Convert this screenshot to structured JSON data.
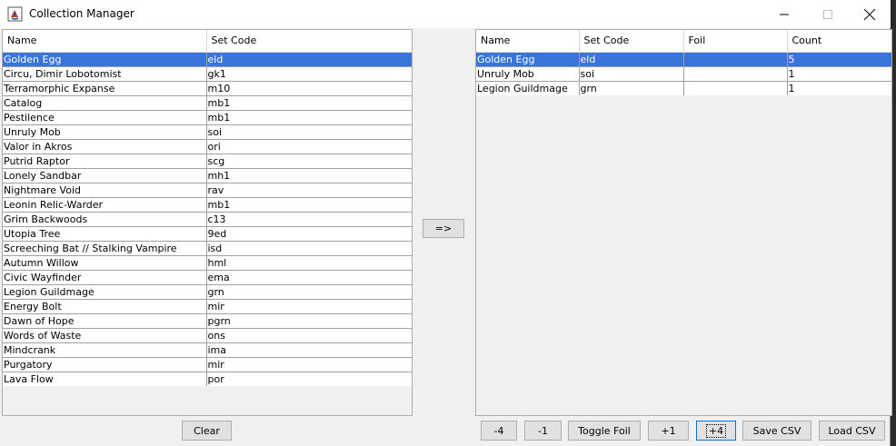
{
  "window": {
    "title": "Collection Manager"
  },
  "left_table": {
    "columns": [
      "Name",
      "Set Code"
    ],
    "rows": [
      {
        "name": "Golden Egg",
        "set": "eld",
        "selected": true
      },
      {
        "name": "Circu, Dimir Lobotomist",
        "set": "gk1"
      },
      {
        "name": "Terramorphic Expanse",
        "set": "m10"
      },
      {
        "name": "Catalog",
        "set": "mb1"
      },
      {
        "name": "Pestilence",
        "set": "mb1"
      },
      {
        "name": "Unruly Mob",
        "set": "soi"
      },
      {
        "name": "Valor in Akros",
        "set": "ori"
      },
      {
        "name": "Putrid Raptor",
        "set": "scg"
      },
      {
        "name": "Lonely Sandbar",
        "set": "mh1"
      },
      {
        "name": "Nightmare Void",
        "set": "rav"
      },
      {
        "name": "Leonin Relic-Warder",
        "set": "mb1"
      },
      {
        "name": "Grim Backwoods",
        "set": "c13"
      },
      {
        "name": "Utopia Tree",
        "set": "9ed"
      },
      {
        "name": "Screeching Bat // Stalking Vampire",
        "set": "isd"
      },
      {
        "name": "Autumn Willow",
        "set": "hml"
      },
      {
        "name": "Civic Wayfinder",
        "set": "ema"
      },
      {
        "name": "Legion Guildmage",
        "set": "grn"
      },
      {
        "name": "Energy Bolt",
        "set": "mir"
      },
      {
        "name": "Dawn of Hope",
        "set": "pgrn"
      },
      {
        "name": "Words of Waste",
        "set": "ons"
      },
      {
        "name": "Mindcrank",
        "set": "ima"
      },
      {
        "name": "Purgatory",
        "set": "mir"
      },
      {
        "name": "Lava Flow",
        "set": "por"
      }
    ]
  },
  "right_table": {
    "columns": [
      "Name",
      "Set Code",
      "Foil",
      "Count"
    ],
    "rows": [
      {
        "name": "Golden Egg",
        "set": "eld",
        "foil": "",
        "count": "5",
        "selected": true
      },
      {
        "name": "Unruly Mob",
        "set": "soi",
        "foil": "",
        "count": "1"
      },
      {
        "name": "Legion Guildmage",
        "set": "grn",
        "foil": "",
        "count": "1"
      }
    ]
  },
  "buttons": {
    "move": "=>",
    "clear": "Clear",
    "minus4": "-4",
    "minus1": "-1",
    "toggle_foil": "Toggle Foil",
    "plus1": "+1",
    "plus4": "+4",
    "save_csv": "Save CSV",
    "load_csv": "Load CSV"
  },
  "colors": {
    "selection": "#3875d7",
    "focus_border": "#0078d7"
  }
}
